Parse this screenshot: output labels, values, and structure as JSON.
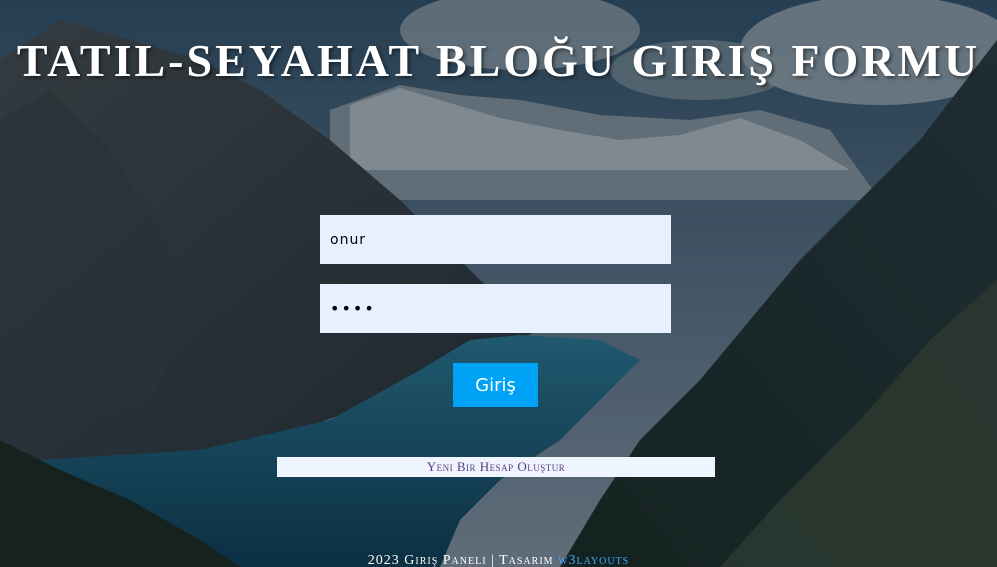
{
  "header": {
    "title": "TATIL-SEYAHAT BLOĞU GIRIŞ FORMU"
  },
  "form": {
    "username_value": "onur",
    "password_value": "••••",
    "submit_label": "Giriş",
    "signup_link": "Yeni Bir Hesap Oluştur"
  },
  "footer": {
    "text": "2023 Giriş Paneli | Tasarım ",
    "link_label": "w3layouts"
  },
  "colors": {
    "button": "#00a2f5",
    "input_bg": "#e8f0fe",
    "link": "#3fa7ff"
  }
}
